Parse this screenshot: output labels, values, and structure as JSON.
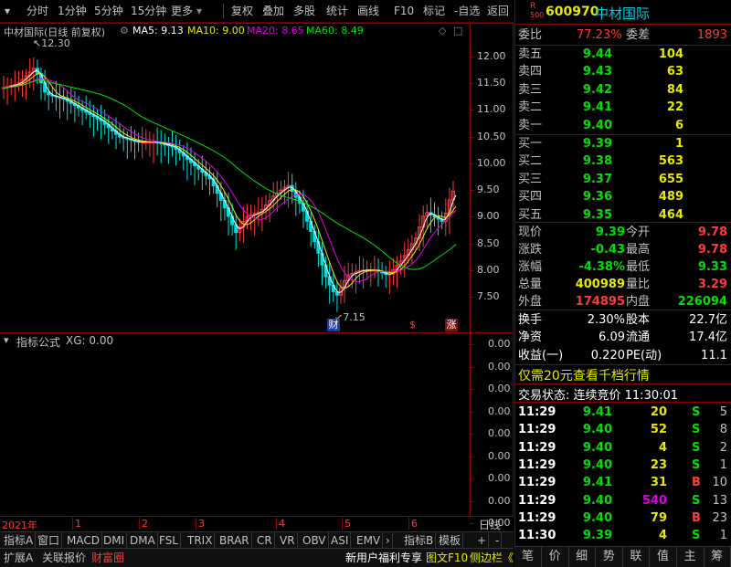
{
  "toolbar": {
    "items": [
      "分时",
      "1分钟",
      "5分钟",
      "15分钟",
      "更多",
      "复权",
      "叠加",
      "多股",
      "统计",
      "画线",
      "F10",
      "标记",
      "-自选",
      "返回"
    ]
  },
  "chart": {
    "title": "中材国际(日线 前复权)",
    "ma5": "MA5: 9.13",
    "ma10": "MA10: 9.00",
    "ma20": "MA20: 8.65",
    "ma60": "MA60: 8.49",
    "high_label": "12.30",
    "low_label": "7.15",
    "event_cai": "财",
    "event_s": "$",
    "event_zhang": "涨",
    "y_ticks": [
      "12.00",
      "11.50",
      "11.00",
      "10.50",
      "10.00",
      "9.50",
      "9.00",
      "8.50",
      "8.00",
      "7.50"
    ],
    "colors": {
      "ma5": "#ffffff",
      "ma10": "#e8e800",
      "ma20": "#e000e0",
      "ma60": "#00e000",
      "up": "#ff3a3a",
      "down": "#00e0e0"
    }
  },
  "chart_data": {
    "type": "candlestick",
    "series": [
      {
        "name": "MA5",
        "color": "#ffffff"
      },
      {
        "name": "MA10",
        "color": "#e8e800"
      },
      {
        "name": "MA20",
        "color": "#e000e0"
      },
      {
        "name": "MA60",
        "color": "#00e000"
      }
    ],
    "ylim": [
      7.15,
      12.3
    ]
  },
  "indicator": {
    "title": "指标公式",
    "xg": "XG: 0.00",
    "y_ticks": [
      "0.00",
      "0.00",
      "0.00",
      "0.00",
      "0.00",
      "0.00",
      "0.00",
      "0.00",
      "0.00"
    ]
  },
  "timeline": {
    "year": "2021年",
    "months": [
      "1",
      "2",
      "3",
      "4",
      "5",
      "6"
    ],
    "period": "日线"
  },
  "tabs": [
    "指标A",
    "窗口",
    "MACD",
    "DMI",
    "DMA",
    "FSL",
    "TRIX",
    "BRAR",
    "CR",
    "VR",
    "OBV",
    "ASI",
    "EMV"
  ],
  "tab_extra": [
    "指标B",
    "模板",
    "+",
    "-"
  ],
  "bottom": {
    "left": [
      "扩展A",
      "关联报价",
      "财富圈"
    ],
    "right": [
      "新用户福利专享",
      "图文F10",
      "侧边栏《"
    ]
  },
  "quote": {
    "code": "600970",
    "name": "中材国际",
    "r_label": "R",
    "r_sub": "500",
    "weibi_label": "委比",
    "weibi": "77.23%",
    "weicha_label": "委差",
    "weicha": "1893",
    "asks": [
      {
        "label": "卖五",
        "price": "9.44",
        "vol": "104"
      },
      {
        "label": "卖四",
        "price": "9.43",
        "vol": "63"
      },
      {
        "label": "卖三",
        "price": "9.42",
        "vol": "84"
      },
      {
        "label": "卖二",
        "price": "9.41",
        "vol": "22"
      },
      {
        "label": "卖一",
        "price": "9.40",
        "vol": "6"
      }
    ],
    "bids": [
      {
        "label": "买一",
        "price": "9.39",
        "vol": "1"
      },
      {
        "label": "买二",
        "price": "9.38",
        "vol": "563"
      },
      {
        "label": "买三",
        "price": "9.37",
        "vol": "655"
      },
      {
        "label": "买四",
        "price": "9.36",
        "vol": "489"
      },
      {
        "label": "买五",
        "price": "9.35",
        "vol": "464"
      }
    ],
    "stats": [
      {
        "l1": "现价",
        "v1": "9.39",
        "c1": "green",
        "l2": "今开",
        "v2": "9.78",
        "c2": "red"
      },
      {
        "l1": "涨跌",
        "v1": "-0.43",
        "c1": "green",
        "l2": "最高",
        "v2": "9.78",
        "c2": "red"
      },
      {
        "l1": "涨幅",
        "v1": "-4.38%",
        "c1": "green",
        "l2": "最低",
        "v2": "9.33",
        "c2": "green"
      },
      {
        "l1": "总量",
        "v1": "400989",
        "c1": "yellow",
        "l2": "量比",
        "v2": "3.29",
        "c2": "red"
      },
      {
        "l1": "外盘",
        "v1": "174895",
        "c1": "red",
        "l2": "内盘",
        "v2": "226094",
        "c2": "green"
      }
    ],
    "stats2": [
      {
        "l1": "换手",
        "v1": "2.30%",
        "l2": "股本",
        "v2": "22.7亿"
      },
      {
        "l1": "净资",
        "v1": "6.09",
        "l2": "流通",
        "v2": "17.4亿"
      },
      {
        "l1": "收益(一)",
        "v1": "0.220",
        "l2": "PE(动)",
        "v2": "11.1"
      }
    ],
    "promo": "仅需20元查看千档行情",
    "status": "交易状态: 连续竞价 11:30:01",
    "ticks": [
      {
        "t": "11:29",
        "p": "9.41",
        "v": "20",
        "bs": "S",
        "n": "5"
      },
      {
        "t": "11:29",
        "p": "9.40",
        "v": "52",
        "bs": "S",
        "n": "8"
      },
      {
        "t": "11:29",
        "p": "9.40",
        "v": "4",
        "bs": "S",
        "n": "2"
      },
      {
        "t": "11:29",
        "p": "9.40",
        "v": "23",
        "bs": "S",
        "n": "1"
      },
      {
        "t": "11:29",
        "p": "9.41",
        "v": "31",
        "bs": "B",
        "n": "10"
      },
      {
        "t": "11:29",
        "p": "9.40",
        "v": "540",
        "bs": "S",
        "n": "13"
      },
      {
        "t": "11:29",
        "p": "9.40",
        "v": "79",
        "bs": "B",
        "n": "23"
      },
      {
        "t": "11:30",
        "p": "9.39",
        "v": "4",
        "bs": "S",
        "n": "1"
      }
    ],
    "bottom_tabs": [
      "笔",
      "价",
      "细",
      "势",
      "联",
      "值",
      "主",
      "筹"
    ]
  }
}
